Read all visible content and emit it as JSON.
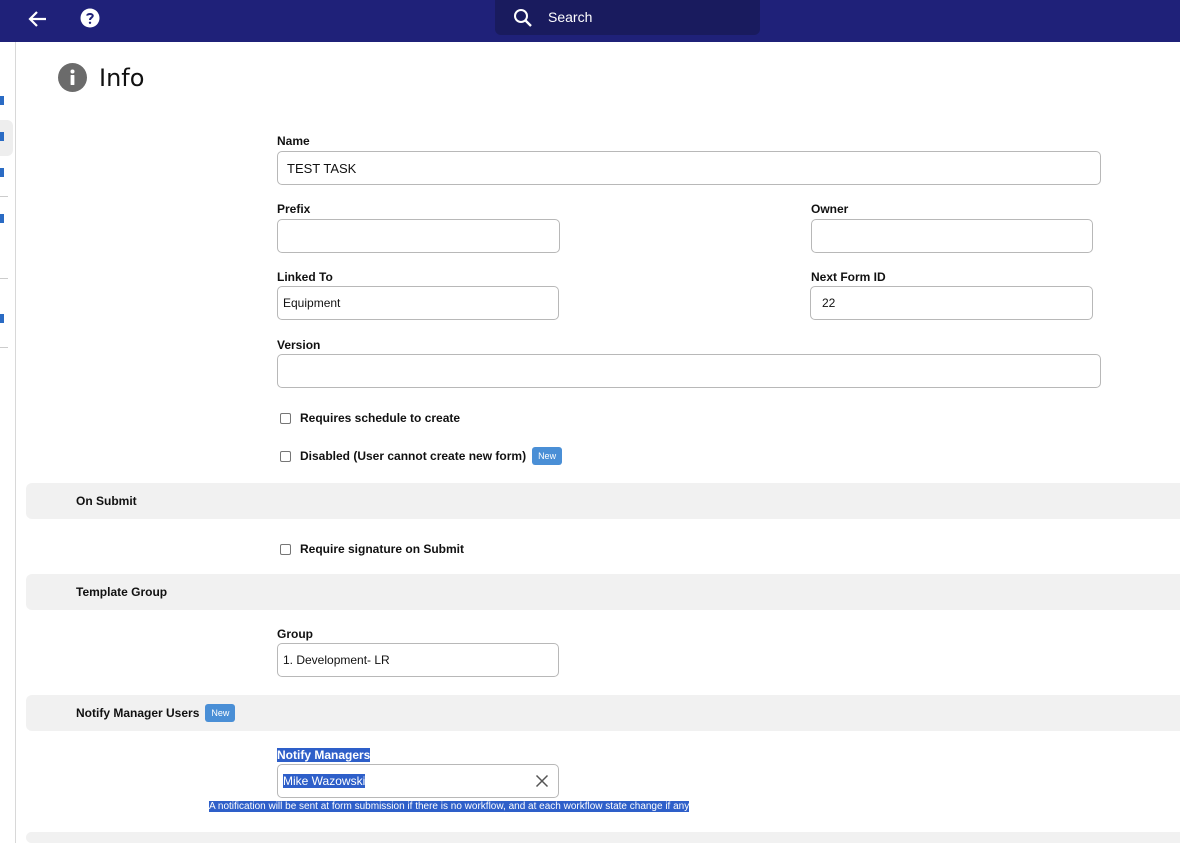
{
  "header": {
    "search_placeholder": "Search"
  },
  "page": {
    "title": "Info"
  },
  "form": {
    "name_label": "Name",
    "name_value": "TEST TASK",
    "prefix_label": "Prefix",
    "prefix_value": "",
    "owner_label": "Owner",
    "owner_value": "",
    "linked_to_label": "Linked To",
    "linked_to_value": "Equipment",
    "next_form_id_label": "Next Form ID",
    "next_form_id_value": "22",
    "version_label": "Version",
    "version_value": "",
    "requires_schedule_label": "Requires schedule to create",
    "requires_schedule_checked": false,
    "disabled_label": "Disabled (User cannot create new form)",
    "disabled_checked": false,
    "new_badge": "New"
  },
  "on_submit": {
    "title": "On Submit",
    "require_signature_label": "Require signature on Submit",
    "require_signature_checked": false
  },
  "template_group": {
    "title": "Template Group",
    "group_label": "Group",
    "group_value": "1. Development- LR"
  },
  "notify_manager_users": {
    "title": "Notify Manager Users",
    "new_badge": "New",
    "notify_managers_label": "Notify Managers",
    "notify_managers_value": "Mike Wazowski",
    "hint": "A notification will be sent at form submission if there is no workflow, and at each workflow state change if any"
  },
  "colors": {
    "topbar": "#1f2179",
    "search_bg": "#191b5e",
    "badge": "#4a8fd6",
    "section_bg": "#f1f1f1",
    "selection": "#2e5fc9"
  }
}
